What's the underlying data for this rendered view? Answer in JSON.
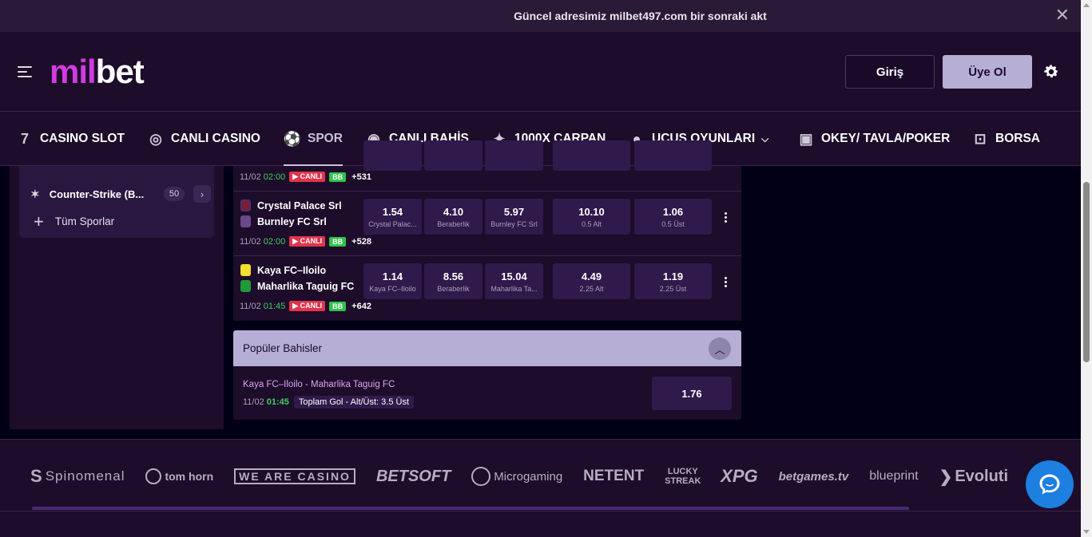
{
  "banner": {
    "text": "Güncel adresimiz milbet497.com bir sonraki akt"
  },
  "header": {
    "logo_a": "mil",
    "logo_b": "bet",
    "login": "Giriş",
    "register": "Üye Ol"
  },
  "nav": [
    {
      "label": "CASINO SLOT",
      "icon": "slot-icon"
    },
    {
      "label": "CANLI CASINO",
      "icon": "chip-icon"
    },
    {
      "label": "SPOR",
      "icon": "football-icon"
    },
    {
      "label": "CANLI BAHİS",
      "icon": "live-icon"
    },
    {
      "label": "1000X ÇARPAN",
      "icon": "star-icon"
    },
    {
      "label": "UCUS OYUNLARI",
      "icon": "rocket-icon"
    },
    {
      "label": "OKEY/ TAVLA/POKER",
      "icon": "cards-icon"
    },
    {
      "label": "BORSA",
      "icon": "gamepad-icon"
    }
  ],
  "sidebar": {
    "sport": "Counter-Strike (B...",
    "count": "50",
    "all_sports": "Tüm Sporlar"
  },
  "matches": [
    {
      "date": "11/02",
      "time": "02:00",
      "live": "CANLI",
      "bb": "BB",
      "more": "+531"
    },
    {
      "home": "Crystal Palace Srl",
      "away": "Burnley FC Srl",
      "date": "11/02",
      "time": "02:00",
      "live": "CANLI",
      "bb": "BB",
      "more": "+528",
      "odds": [
        {
          "v": "1.54",
          "l": "Crystal Palac..."
        },
        {
          "v": "4.10",
          "l": "Beraberlik"
        },
        {
          "v": "5.97",
          "l": "Burnley FC Srl"
        },
        {
          "v": "10.10",
          "l": "0.5 Alt"
        },
        {
          "v": "1.06",
          "l": "0.5 Üst"
        }
      ]
    },
    {
      "home": "Kaya FC–Iloilo",
      "away": "Maharlika Taguig FC",
      "date": "11/02",
      "time": "01:45",
      "live": "CANLI",
      "bb": "BB",
      "more": "+642",
      "odds": [
        {
          "v": "1.14",
          "l": "Kaya FC–Iloilo"
        },
        {
          "v": "8.56",
          "l": "Beraberlik"
        },
        {
          "v": "15.04",
          "l": "Maharlika Ta..."
        },
        {
          "v": "4.49",
          "l": "2.25 Alt"
        },
        {
          "v": "1.19",
          "l": "2.25 Üst"
        }
      ]
    }
  ],
  "popular": {
    "title": "Popüler Bahisler",
    "match": "Kaya FC–Iloilo - Maharlika Taguig FC",
    "date": "11/02",
    "time": "01:45",
    "market": "Toplam Gol - Alt/Üst: 3.5 Üst",
    "odd": "1.76"
  },
  "providers": [
    "Spinomenal",
    "tom horn",
    "WE ARE CASINO",
    "BETSOFT",
    "Microgaming",
    "NETENT",
    "LUCKY STREAK",
    "XPG",
    "betgames.tv",
    "blueprint",
    "Evoluti"
  ]
}
